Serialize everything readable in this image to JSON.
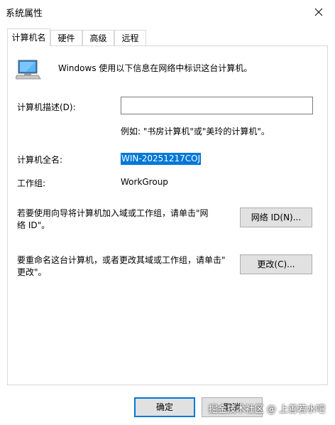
{
  "window": {
    "title": "系统属性"
  },
  "tabs": [
    {
      "label": "计算机名",
      "active": true
    },
    {
      "label": "硬件",
      "active": false
    },
    {
      "label": "高级",
      "active": false
    },
    {
      "label": "远程",
      "active": false
    }
  ],
  "main": {
    "intro": "Windows 使用以下信息在网络中标识这台计算机。",
    "description_label": "计算机描述(D):",
    "description_value": "",
    "description_example": "例如: \"书房计算机\"或\"美玲的计算机\"。",
    "fullname_label": "计算机全名:",
    "fullname_value": "WIN-20251217COJ",
    "workgroup_label": "工作组:",
    "workgroup_value": "WorkGroup",
    "netid_text_line1": "若要使用向导将计算机加入域或工作组，请单击\"网",
    "netid_text_line2": "络 ID\"。",
    "netid_button": "网络 ID(N)...",
    "rename_text_line1": "要重命名这台计算机，或者更改其域或工作组，请单击\"",
    "rename_text_line2": "更改\"。",
    "change_button": "更改(C)..."
  },
  "footer": {
    "ok_button": "确定",
    "cancel_button": "取消"
  },
  "watermark": "掘金技术社区 @ 上善若水吧",
  "colors": {
    "accent": "#0078d7",
    "button_bg": "#e1e1e1",
    "border": "#adadad"
  }
}
